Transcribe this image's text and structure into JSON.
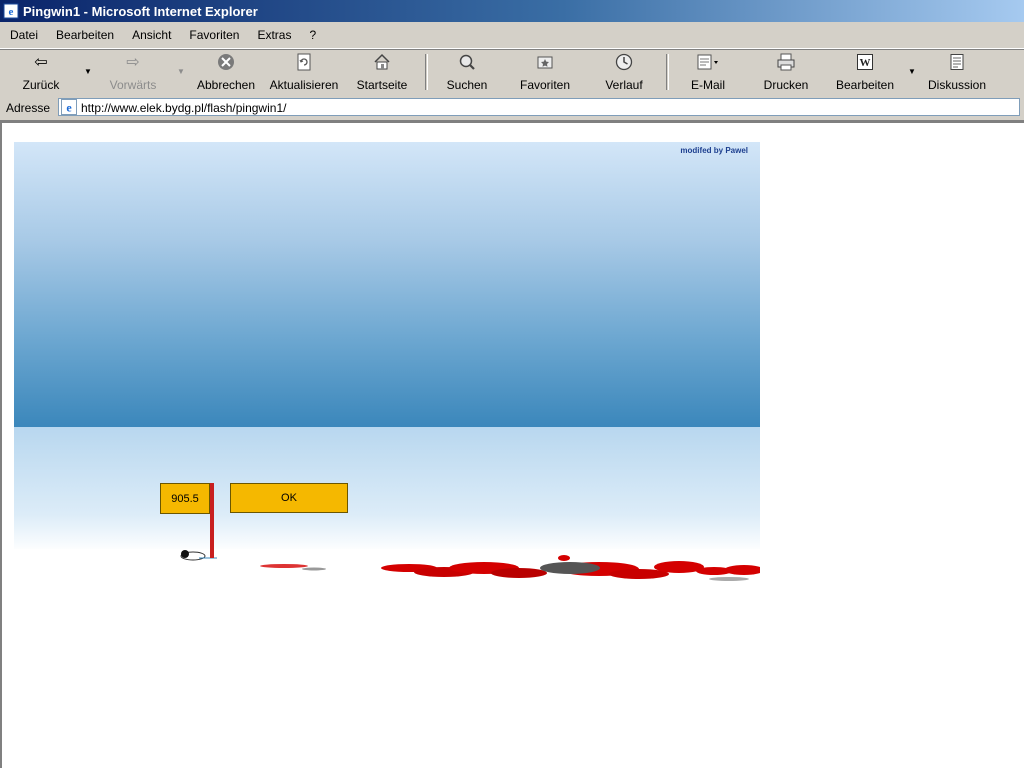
{
  "window": {
    "title": "Pingwin1 - Microsoft Internet Explorer"
  },
  "menu": [
    "Datei",
    "Bearbeiten",
    "Ansicht",
    "Favoriten",
    "Extras",
    "?"
  ],
  "toolbar": {
    "back": "Zurück",
    "forward": "Vorwärts",
    "stop": "Abbrechen",
    "refresh": "Aktualisieren",
    "home": "Startseite",
    "search": "Suchen",
    "favorites": "Favoriten",
    "history": "Verlauf",
    "mail": "E-Mail",
    "print": "Drucken",
    "edit": "Bearbeiten",
    "discuss": "Diskussion"
  },
  "address": {
    "label": "Adresse",
    "url": "http://www.elek.bydg.pl/flash/pingwin1/"
  },
  "game": {
    "credit": "modifed by Pawel",
    "distance": "905.5",
    "ok_label": "OK"
  },
  "colors": {
    "flag_yellow": "#f5b800",
    "blood_red": "#d40000",
    "sky_top": "#d3e6f8",
    "sky_bottom": "#3b87bb"
  }
}
